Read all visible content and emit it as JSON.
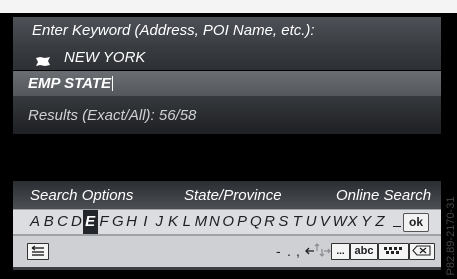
{
  "header": {
    "title": "Enter Keyword (Address, POI Name, etc.):"
  },
  "location": {
    "value": "NEW YORK",
    "flag_icon": "us-flag-icon"
  },
  "input": {
    "value": "EMP STATE"
  },
  "results": {
    "text": "Results (Exact/All): 56/58"
  },
  "options": {
    "search_options": "Search Options",
    "state_province": "State/Province",
    "online_search": "Online Search"
  },
  "keyboard": {
    "letters": [
      "A",
      "B",
      "C",
      "D",
      "E",
      "F",
      "G",
      "H",
      "I",
      "J",
      "K",
      "L",
      "M",
      "N",
      "O",
      "P",
      "Q",
      "R",
      "S",
      "T",
      "U",
      "V",
      "W",
      "X",
      "Y",
      "Z"
    ],
    "selected_letter": "E",
    "ok_label": "ok",
    "space_icon": "space-underscore-icon",
    "punct": [
      "-",
      ".",
      ","
    ],
    "arrow_left_icon": "arrow-left-icon",
    "arrow_up_icon": "arrow-up-icon",
    "arrow_down_icon": "arrow-down-icon",
    "arrow_right_icon": "arrow-right-icon",
    "dots_label": "...",
    "abc_label": "abc",
    "mode_icon": "keypad-mode-icon",
    "delete_icon": "delete-icon",
    "back_icon": "back-icon"
  },
  "image_code": "P82.89-2170-31",
  "colors": {
    "screen_bg": "#000000",
    "header_bg": "#4e5258",
    "keyboard_bg": "#dcdde0",
    "selected_key": "#23262a"
  }
}
